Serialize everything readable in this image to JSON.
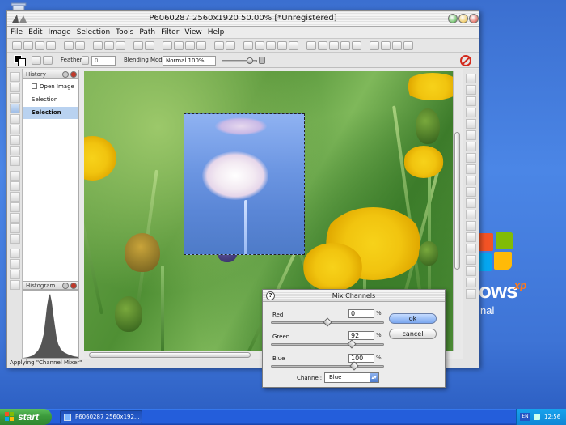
{
  "window": {
    "title": "P6060287 2560x1920 50.00% [*Unregistered]"
  },
  "menu": [
    "File",
    "Edit",
    "Image",
    "Selection",
    "Tools",
    "Path",
    "Filter",
    "View",
    "Help"
  ],
  "options": {
    "feather_label": "Feather",
    "feather_value": "0",
    "blending_label": "Blending Mode:",
    "blending_value": "Normal 100%"
  },
  "history": {
    "title": "History",
    "items": [
      "Open Image",
      "Selection",
      "Selection"
    ]
  },
  "histogram": {
    "title": "Histogram"
  },
  "status": {
    "text": "Applying \"Channel Mixer\""
  },
  "dialog": {
    "title": "Mix Channels",
    "help": "?",
    "red_label": "Red",
    "red_value": "0",
    "green_label": "Green",
    "green_value": "92",
    "blue_label": "Blue",
    "blue_value": "100",
    "percent": "%",
    "ok_label": "ok",
    "cancel_label": "cancel",
    "channel_label": "Channel:",
    "channel_value": "Blue",
    "channel_arrow": "▴▾",
    "red_level": 0,
    "green_level": 92,
    "blue_level": 100
  },
  "taskbar": {
    "start_label": "start",
    "task_title": "P6060287 2560x192...",
    "lang": "EN",
    "clock": "12:56"
  },
  "desktop": {
    "brand_text": "ows",
    "brand_sup": "xp",
    "brand_sub": "nal"
  },
  "colors": {
    "accent": "#245edb",
    "selection": "#b9d2f0",
    "ok_button": "#7aa7ef"
  }
}
